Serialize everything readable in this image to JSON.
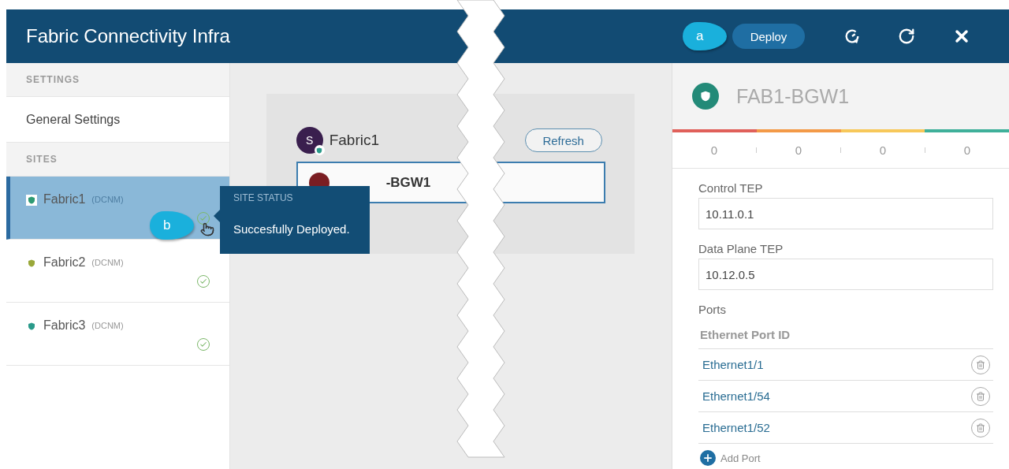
{
  "header": {
    "title": "Fabric Connectivity Infra",
    "deploy_button": "Deploy"
  },
  "sidebar": {
    "settings_heading": "SETTINGS",
    "settings_items": [
      {
        "label": "General Settings",
        "selected": false
      }
    ],
    "sites_heading": "SITES",
    "sites": [
      {
        "name": "Fabric1",
        "type": "(DCNM)",
        "selected": true
      },
      {
        "name": "Fabric2",
        "type": "(DCNM)",
        "selected": false
      },
      {
        "name": "Fabric3",
        "type": "(DCNM)",
        "selected": false
      }
    ]
  },
  "tooltip": {
    "heading": "SITE STATUS",
    "message": "Succesfully Deployed."
  },
  "site_card": {
    "avatar": "S",
    "name": "Fabric1",
    "refresh_button": "Refresh",
    "device": "-BGW1"
  },
  "detail": {
    "device_name": "FAB1-BGW1",
    "counts": [
      {
        "value": "0",
        "color": "#e0605a"
      },
      {
        "value": "0",
        "color": "#f39a48"
      },
      {
        "value": "0",
        "color": "#f7c85a"
      },
      {
        "value": "0",
        "color": "#3fb09a"
      }
    ],
    "fields": [
      {
        "label": "Control TEP",
        "value": "10.11.0.1"
      },
      {
        "label": "Data Plane TEP",
        "value": "10.12.0.5"
      }
    ],
    "ports_label": "Ports",
    "ports_column": "Ethernet Port ID",
    "ports": [
      "Ethernet1/1",
      "Ethernet1/54",
      "Ethernet1/52"
    ],
    "add_port": "Add Port"
  },
  "annotations": [
    {
      "kind": "deploy",
      "label": "a"
    },
    {
      "kind": "status",
      "label": "b"
    }
  ]
}
